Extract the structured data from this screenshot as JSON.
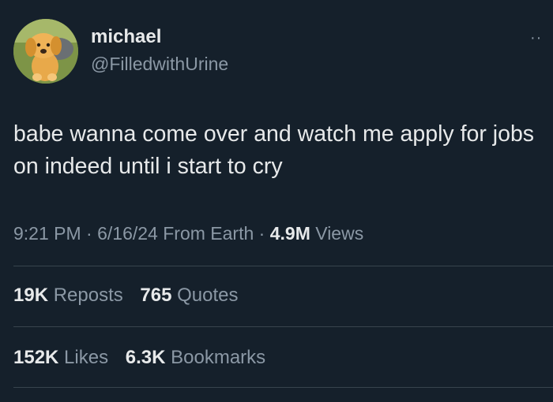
{
  "author": {
    "display_name": "michael",
    "handle": "@FilledwithUrine"
  },
  "more_menu_label": "··",
  "tweet": {
    "text": "babe wanna come over and watch me apply for jobs on indeed until i start to cry"
  },
  "meta": {
    "time": "9:21 PM",
    "date": "6/16/24",
    "source": "From Earth",
    "separator": " · ",
    "views_count": "4.9M",
    "views_label": "Views"
  },
  "stats": {
    "reposts_count": "19K",
    "reposts_label": "Reposts",
    "quotes_count": "765",
    "quotes_label": "Quotes",
    "likes_count": "152K",
    "likes_label": "Likes",
    "bookmarks_count": "6.3K",
    "bookmarks_label": "Bookmarks"
  },
  "colors": {
    "background": "#15202b",
    "primary_text": "#e7e9ea",
    "secondary_text": "#8b98a5",
    "divider": "#38444d"
  }
}
